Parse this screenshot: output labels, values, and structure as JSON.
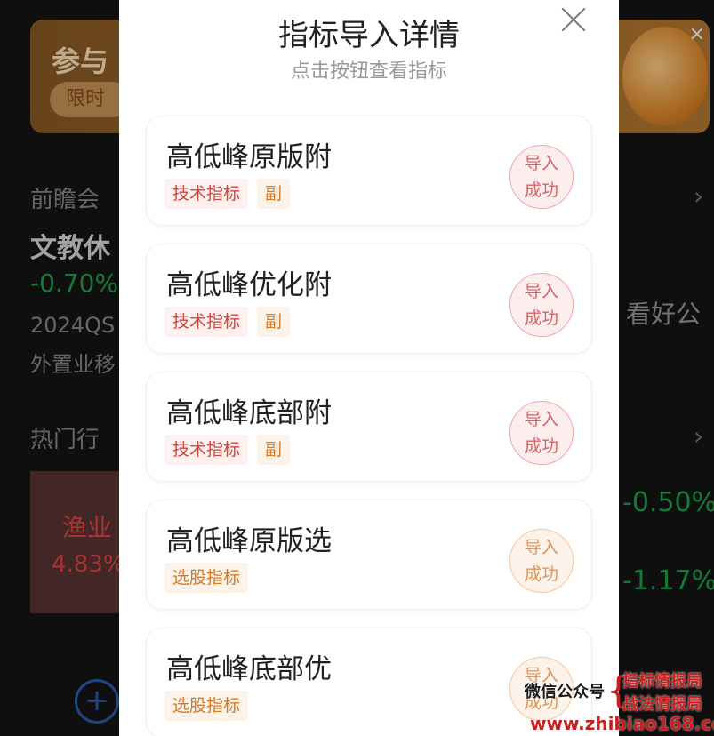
{
  "background": {
    "banner_title": "参与",
    "banner_pill": "限时",
    "banner_close": "×",
    "section1_heading": "前瞻会",
    "stock_name": "文教休",
    "stock_change": "-0.70%",
    "note_line1": "2024QS",
    "note_line2": "外置业移",
    "right_text": "看好公",
    "section2_heading": "热门行",
    "tile_name": "渔业",
    "tile_value": "4.83%",
    "right_value1": "-0.50%",
    "right_value2": "-1.17%",
    "chevron": "›",
    "plus_icon": "+"
  },
  "modal": {
    "title": "指标导入详情",
    "subtitle": "点击按钮查看指标",
    "stamp_line1": "导入",
    "stamp_line2": "成功",
    "items": [
      {
        "name": "高低峰原版附",
        "tags": [
          "技术指标",
          "副"
        ],
        "stamp_color": "red"
      },
      {
        "name": "高低峰优化附",
        "tags": [
          "技术指标",
          "副"
        ],
        "stamp_color": "red"
      },
      {
        "name": "高低峰底部附",
        "tags": [
          "技术指标",
          "副"
        ],
        "stamp_color": "red"
      },
      {
        "name": "高低峰原版选",
        "tags": [
          "选股指标"
        ],
        "stamp_color": "orange"
      },
      {
        "name": "高低峰底部优",
        "tags": [
          "选股指标"
        ],
        "stamp_color": "orange"
      }
    ]
  },
  "watermark": {
    "label": "微信公众号",
    "brace": "{",
    "line1": "指标情报局",
    "line2": "战法情报局",
    "url": "www.zhibiao168.com"
  },
  "colors": {
    "stamp_red": "#d86464",
    "stamp_orange": "#e09456",
    "tag_red": "#c84a3e",
    "tag_orange": "#d07b2a",
    "watermark_red": "#c81e1e"
  }
}
